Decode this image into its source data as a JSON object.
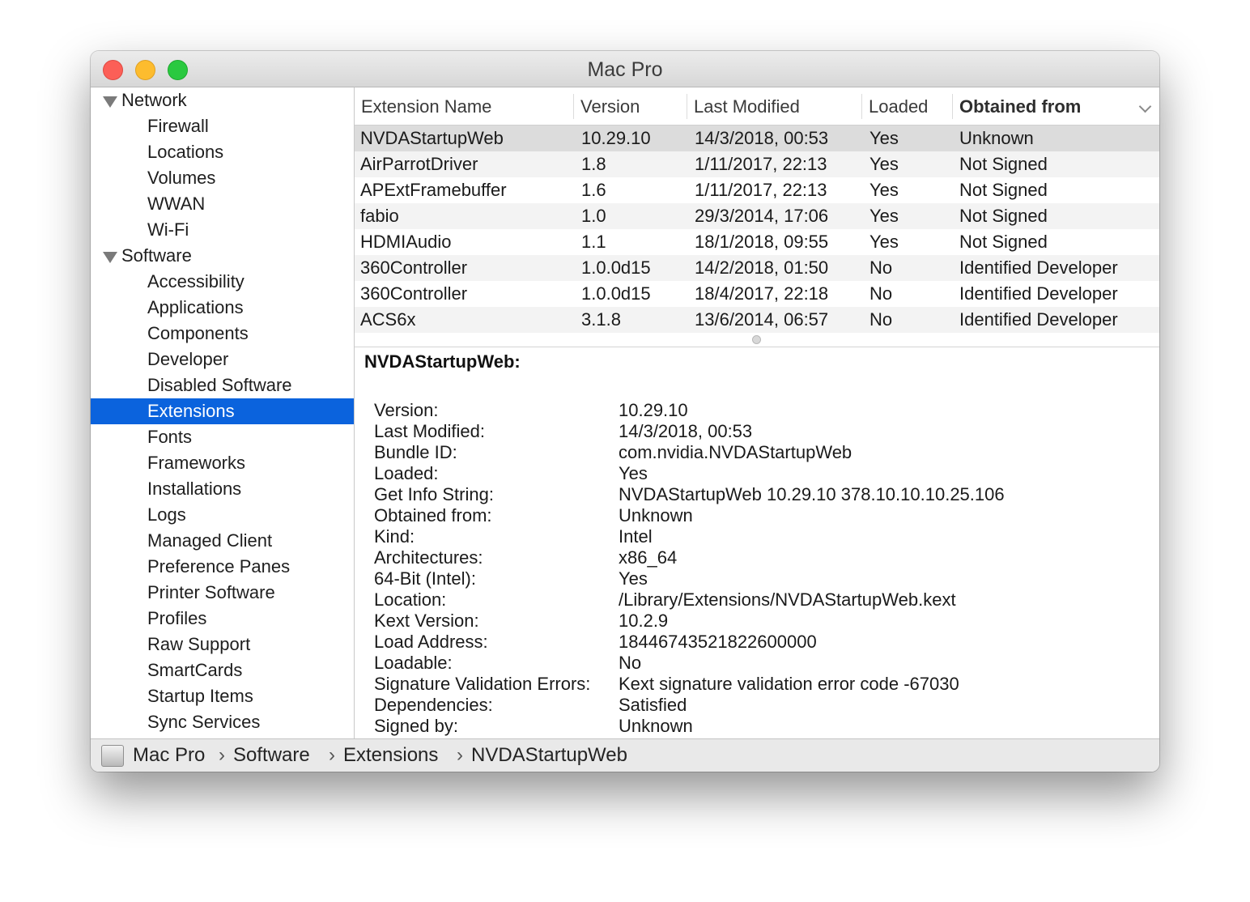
{
  "window": {
    "title": "Mac Pro"
  },
  "sidebar": {
    "groups": [
      {
        "label": "Network",
        "items": [
          "Firewall",
          "Locations",
          "Volumes",
          "WWAN",
          "Wi-Fi"
        ]
      },
      {
        "label": "Software",
        "items": [
          "Accessibility",
          "Applications",
          "Components",
          "Developer",
          "Disabled Software",
          "Extensions",
          "Fonts",
          "Frameworks",
          "Installations",
          "Logs",
          "Managed Client",
          "Preference Panes",
          "Printer Software",
          "Profiles",
          "Raw Support",
          "SmartCards",
          "Startup Items",
          "Sync Services"
        ]
      }
    ],
    "selected": "Extensions"
  },
  "table": {
    "columns": [
      "Extension Name",
      "Version",
      "Last Modified",
      "Loaded",
      "Obtained from"
    ],
    "sorted_column": "Obtained from",
    "sort_icon": "chevron-down-icon",
    "rows": [
      [
        "NVDAStartupWeb",
        "10.29.10",
        "14/3/2018, 00:53",
        "Yes",
        "Unknown"
      ],
      [
        "AirParrotDriver",
        "1.8",
        "1/11/2017, 22:13",
        "Yes",
        "Not Signed"
      ],
      [
        "APExtFramebuffer",
        "1.6",
        "1/11/2017, 22:13",
        "Yes",
        "Not Signed"
      ],
      [
        "fabio",
        "1.0",
        "29/3/2014, 17:06",
        "Yes",
        "Not Signed"
      ],
      [
        "HDMIAudio",
        "1.1",
        "18/1/2018, 09:55",
        "Yes",
        "Not Signed"
      ],
      [
        "360Controller",
        "1.0.0d15",
        "14/2/2018, 01:50",
        "No",
        "Identified Developer"
      ],
      [
        "360Controller",
        "1.0.0d15",
        "18/4/2017, 22:18",
        "No",
        "Identified Developer"
      ],
      [
        "ACS6x",
        "3.1.8",
        "13/6/2014, 06:57",
        "No",
        "Identified Developer"
      ]
    ],
    "selected_row": 0
  },
  "detail": {
    "title": "NVDAStartupWeb:",
    "fields": [
      {
        "label": "Version:",
        "value": "10.29.10"
      },
      {
        "label": "Last Modified:",
        "value": "14/3/2018, 00:53"
      },
      {
        "label": "Bundle ID:",
        "value": "com.nvidia.NVDAStartupWeb"
      },
      {
        "label": "Loaded:",
        "value": "Yes"
      },
      {
        "label": "Get Info String:",
        "value": "NVDAStartupWeb 10.29.10 378.10.10.10.25.106"
      },
      {
        "label": "Obtained from:",
        "value": "Unknown"
      },
      {
        "label": "Kind:",
        "value": "Intel"
      },
      {
        "label": "Architectures:",
        "value": "x86_64"
      },
      {
        "label": "64-Bit (Intel):",
        "value": "Yes"
      },
      {
        "label": "Location:",
        "value": "/Library/Extensions/NVDAStartupWeb.kext"
      },
      {
        "label": "Kext Version:",
        "value": "10.2.9"
      },
      {
        "label": "Load Address:",
        "value": "18446743521822600000"
      },
      {
        "label": "Loadable:",
        "value": "No"
      },
      {
        "label": "Signature Validation Errors:",
        "value": "Kext signature validation error code -67030"
      },
      {
        "label": "Dependencies:",
        "value": "Satisfied"
      },
      {
        "label": "Signed by:",
        "value": "Unknown"
      }
    ]
  },
  "pathbar": {
    "icon": "computer-icon",
    "crumbs": [
      "Mac Pro",
      "Software",
      "Extensions",
      "NVDAStartupWeb"
    ],
    "separator": "›"
  },
  "colors": {
    "selection": "#0b63dd",
    "close": "#fc5f57",
    "minimize": "#fdbc2e",
    "maximize": "#2ac940"
  }
}
